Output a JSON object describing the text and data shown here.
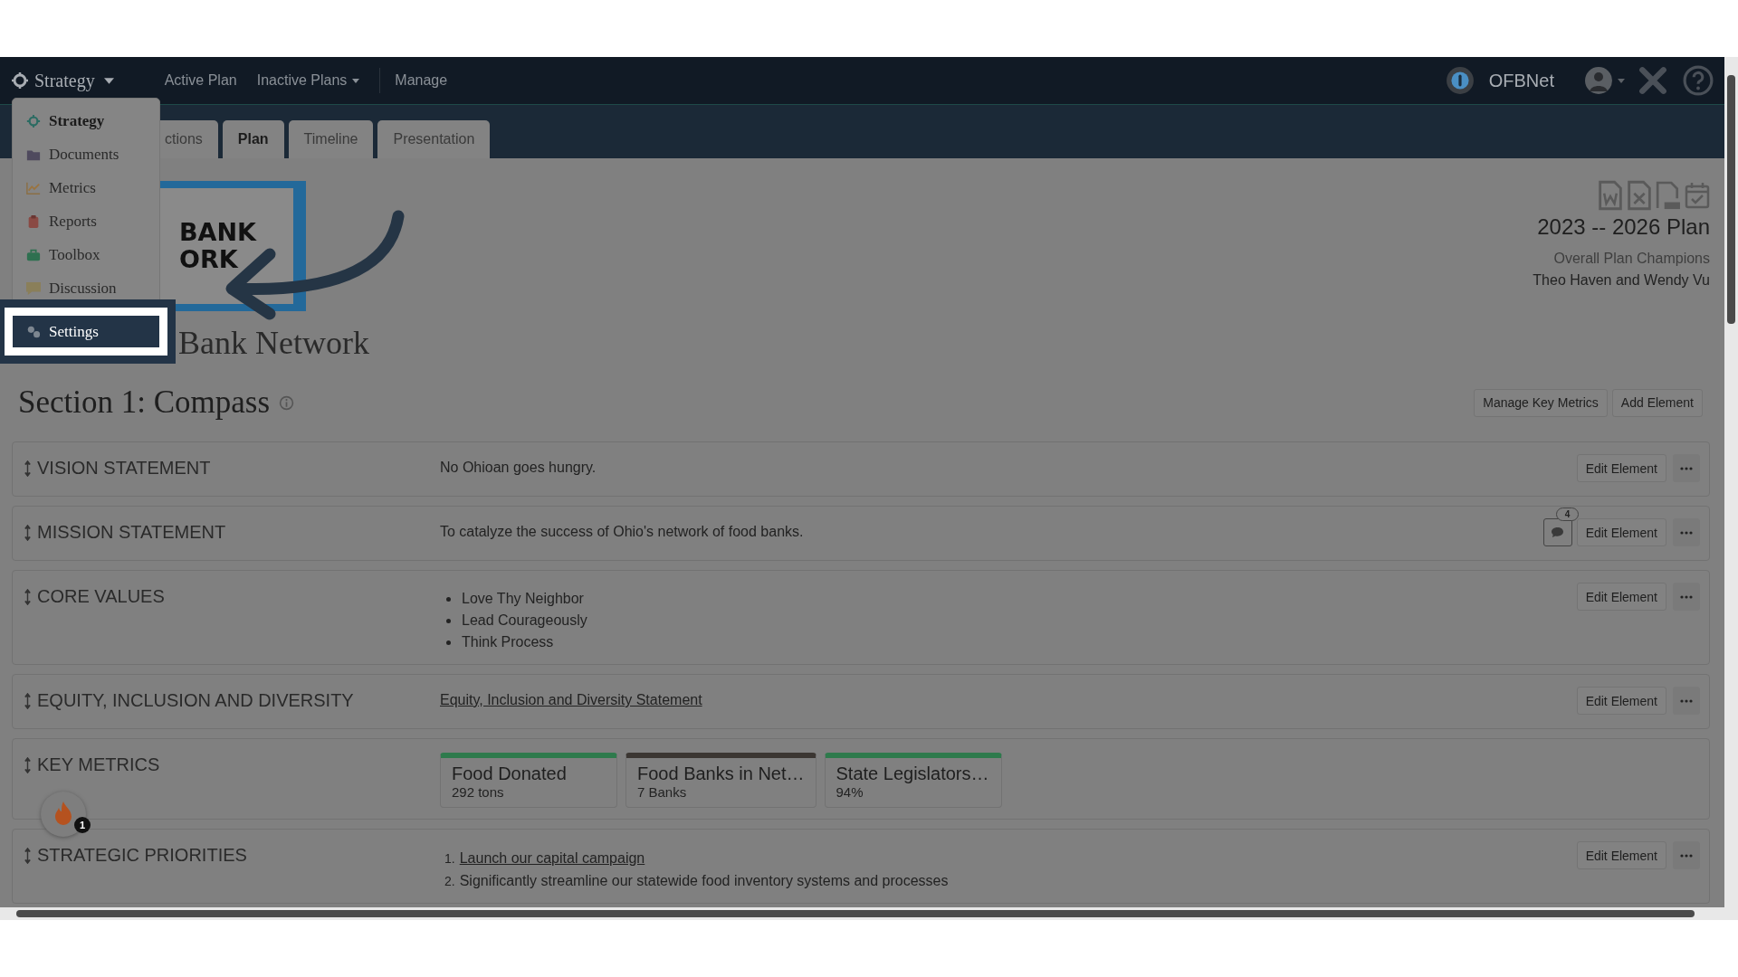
{
  "top_nav": {
    "brand": "Strategy",
    "links": [
      {
        "label": "Active Plan",
        "dropdown": false
      },
      {
        "label": "Inactive Plans",
        "dropdown": true
      },
      {
        "label": "Manage",
        "dropdown": false
      }
    ],
    "org": "OFBNet"
  },
  "menu": {
    "items": [
      {
        "label": "Strategy",
        "selected": true,
        "highlighted": false
      },
      {
        "label": "Documents",
        "selected": false,
        "highlighted": false
      },
      {
        "label": "Metrics",
        "selected": false,
        "highlighted": false
      },
      {
        "label": "Reports",
        "selected": false,
        "highlighted": false
      },
      {
        "label": "Toolbox",
        "selected": false,
        "highlighted": false
      },
      {
        "label": "Discussion",
        "selected": false,
        "highlighted": false
      },
      {
        "label": "Settings",
        "selected": false,
        "highlighted": true
      }
    ]
  },
  "tabs": [
    {
      "label": "ctions",
      "selected": false
    },
    {
      "label": "Plan",
      "selected": true
    },
    {
      "label": "Timeline",
      "selected": false
    },
    {
      "label": "Presentation",
      "selected": false
    }
  ],
  "logo": {
    "lines": [
      "BANK",
      "ORK"
    ]
  },
  "org_name": "Bank Network",
  "plan": {
    "title": "2023 -- 2026 Plan",
    "champions_label": "Overall Plan Champions",
    "champions": "Theo Haven and Wendy Vu"
  },
  "section": {
    "title": "Section 1: Compass",
    "buttons": [
      "Manage Key Metrics",
      "Add Element"
    ]
  },
  "elements": [
    {
      "kind": "text",
      "label": "VISION STATEMENT",
      "text": "No Ohioan goes hungry.",
      "edit": "Edit Element"
    },
    {
      "kind": "text",
      "label": "MISSION STATEMENT",
      "text": "To catalyze the success of Ohio's network of food banks.",
      "comment_count": "4",
      "edit": "Edit Element"
    },
    {
      "kind": "bullets",
      "label": "CORE VALUES",
      "items": [
        "Love Thy Neighbor",
        "Lead Courageously",
        "Think Process"
      ],
      "edit": "Edit Element"
    },
    {
      "kind": "link",
      "label": "EQUITY, INCLUSION AND DIVERSITY",
      "text": "Equity, Inclusion and Diversity Statement",
      "edit": "Edit Element"
    },
    {
      "kind": "metrics",
      "label": "KEY METRICS",
      "metrics": [
        {
          "title": "Food Donated",
          "value": "292 tons",
          "color": "#2e7a4c"
        },
        {
          "title": "Food Banks in Net…",
          "value": "7 Banks",
          "color": "#3b3632"
        },
        {
          "title": "State Legislators…",
          "value": "94%",
          "color": "#2e7a4c"
        }
      ]
    },
    {
      "kind": "numbered",
      "label": "STRATEGIC PRIORITIES",
      "items": [
        {
          "number": "1.",
          "text": "Launch our capital campaign",
          "link": true
        },
        {
          "number": "2.",
          "text": "Significantly streamline our statewide food inventory systems and processes",
          "link": false
        }
      ],
      "edit": "Edit Element"
    }
  ],
  "help_bubble": {
    "badge": "1"
  }
}
